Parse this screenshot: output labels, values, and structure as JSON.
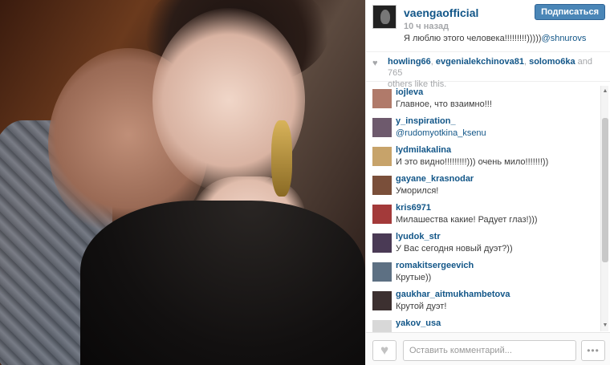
{
  "post": {
    "username": "vaengaofficial",
    "time": "10 ч назад",
    "caption_text": "Я люблю этого человека!!!!!!!!!)))))",
    "caption_mention": "@shnurovs",
    "follow_label": "Подписаться",
    "photo_icon": "photo"
  },
  "likes": {
    "user1": "howling66",
    "sep1": ", ",
    "user2": "evgenialekchinova81",
    "sep2": ", ",
    "user3": "solomo6ka",
    "and_text": " and ",
    "count": "765",
    "tail": "others like this."
  },
  "comments": [
    {
      "user": "iojleva",
      "text": "Главное, что взаимно!!!",
      "avatar_color": "#b07a6a"
    },
    {
      "user": "y_inspiration_",
      "text": "@rudomyotkina_ksenu",
      "avatar_color": "#6e5a6d"
    },
    {
      "user": "lydmilakalina",
      "text": "И это видно!!!!!!!!!))) очень мило!!!!!!!))",
      "avatar_color": "#c7a36a"
    },
    {
      "user": "gayane_krasnodar",
      "text": "Уморился!",
      "avatar_color": "#7a4f3a"
    },
    {
      "user": "kris6971",
      "text": "Милашества какие! Радует глаз!)))",
      "avatar_color": "#a33a3a"
    },
    {
      "user": "lyudok_str",
      "text": "У Вас сегодня новый дуэт?))",
      "avatar_color": "#4a3a55"
    },
    {
      "user": "romakitsergeevich",
      "text": "Крутые))",
      "avatar_color": "#5d7083"
    },
    {
      "user": "gaukhar_aitmukhambetova",
      "text": "Крутой дуэт!",
      "avatar_color": "#3c3030"
    },
    {
      "user": "yakov_usa",
      "text": "",
      "avatar_color": "#d8d8d8"
    }
  ],
  "footer": {
    "comment_placeholder": "Оставить комментарий...",
    "more_label": "•••",
    "like_icon": "heart"
  }
}
